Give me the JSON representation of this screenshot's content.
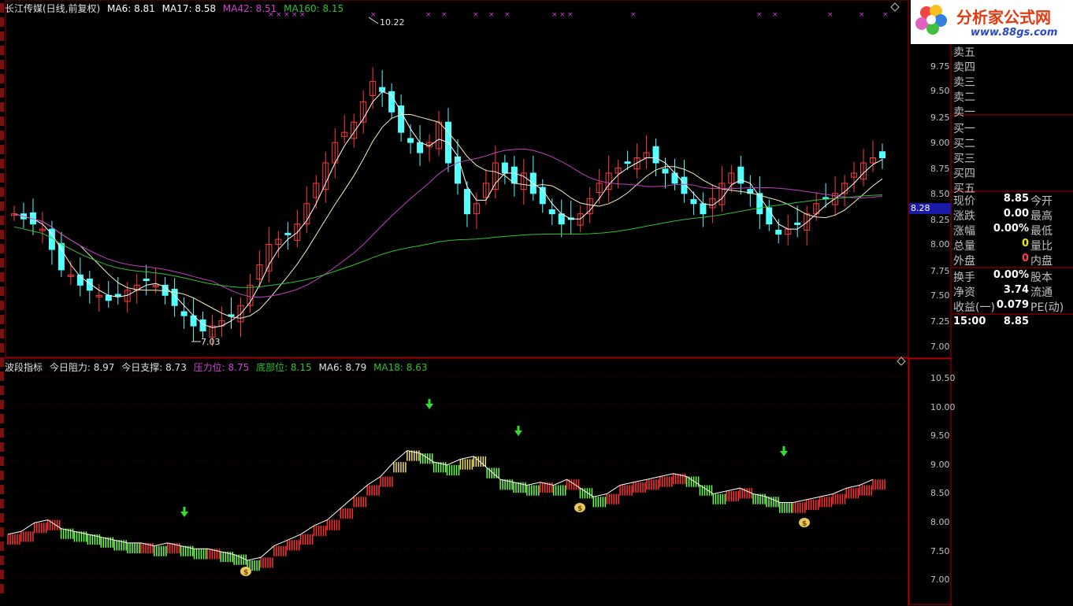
{
  "main_header": {
    "title": "长江传媒(日线,前复权)",
    "ma": [
      {
        "label": "MA6: 8.81",
        "color": "#ffffff"
      },
      {
        "label": "MA17: 8.58",
        "color": "#ffffff"
      },
      {
        "label": "MA42: 8.51",
        "color": "#d040d0"
      },
      {
        "label": "MA160: 8.15",
        "color": "#30c030"
      }
    ]
  },
  "indicator_header": {
    "name": "波段指标",
    "items": [
      {
        "label": "今日阻力: 8.97",
        "color": "#c0c0c0"
      },
      {
        "label": "今日支撑: 8.73",
        "color": "#c0c0c0"
      },
      {
        "label": "压力位: 8.75",
        "color": "#d040d0"
      },
      {
        "label": "底部位: 8.15",
        "color": "#30c030"
      },
      {
        "label": "MA6: 8.79",
        "color": "#c0c0c0"
      },
      {
        "label": "MA18: 8.63",
        "color": "#30c030"
      }
    ]
  },
  "price_axis": [
    "9.75",
    "9.50",
    "9.25",
    "9.00",
    "8.75",
    "8.50",
    "8.25",
    "8.00",
    "7.75",
    "7.50",
    "7.25",
    "7.00"
  ],
  "indicator_axis": [
    "10.50",
    "10.00",
    "9.50",
    "9.00",
    "8.50",
    "8.00",
    "7.50",
    "7.00"
  ],
  "price_marker": "8.28",
  "annotations": {
    "high": "10.22",
    "low": "7.03"
  },
  "logo": {
    "text": "分析家公式网",
    "url": "www.88gs.com"
  },
  "order_book": {
    "sell": [
      "卖五",
      "卖四",
      "卖三",
      "卖二",
      "卖一"
    ],
    "buy": [
      "买一",
      "买二",
      "买三",
      "买四",
      "买五"
    ]
  },
  "quote": [
    {
      "label": "现价",
      "value": "8.85",
      "right": "今开",
      "value_color": "#ffffff"
    },
    {
      "label": "涨跌",
      "value": "0.00",
      "right": "最高",
      "value_color": "#ffffff"
    },
    {
      "label": "涨幅",
      "value": "0.00%",
      "right": "最低",
      "value_color": "#ffffff"
    },
    {
      "label": "总量",
      "value": "0",
      "right": "量比",
      "value_color": "#e8e800"
    },
    {
      "label": "外盘",
      "value": "0",
      "right": "内盘",
      "value_color": "#ff4040"
    },
    {
      "label": "换手",
      "value": "0.00%",
      "right": "股本",
      "value_color": "#ffffff"
    },
    {
      "label": "净资",
      "value": "3.74",
      "right": "流通",
      "value_color": "#ffffff"
    },
    {
      "label": "收益(一)",
      "value": "0.079",
      "right": "PE(动)",
      "value_color": "#ffffff"
    },
    {
      "label": "15:00",
      "value": "8.85",
      "right": "",
      "value_color": "#ffffff"
    }
  ],
  "colors": {
    "up": "#ff3c3c",
    "down": "#54ffff",
    "ma42": "#c040c0",
    "ma160": "#30c030",
    "grid_red": "#8a0000"
  }
}
